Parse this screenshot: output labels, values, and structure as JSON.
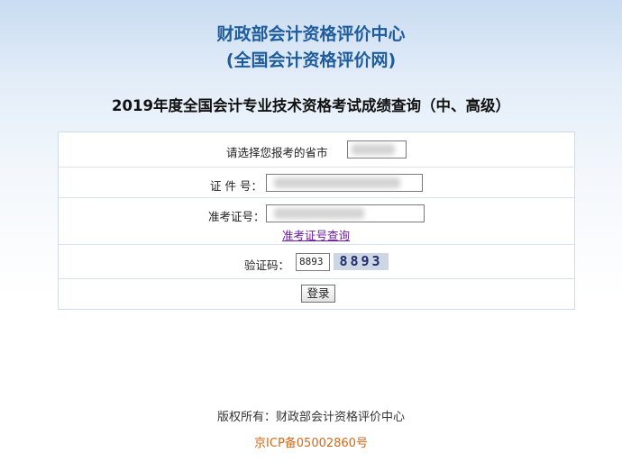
{
  "header": {
    "org_name": "财政部会计资格评价中心",
    "site_name": "(全国会计资格评价网)",
    "query_title": "2019年度全国会计专业技术资格考试成绩查询（中、高级）"
  },
  "form": {
    "province_label": "请选择您报考的省市",
    "id_label": "证 件 号：",
    "admission_label": "准考证号：",
    "admission_lookup_link": "准考证号查询",
    "captcha_label": "验证码：",
    "captcha_input_value": "8893",
    "captcha_image_text": "8893",
    "login_button": "登录"
  },
  "footer": {
    "copyright": "版权所有：财政部会计资格评价中心",
    "icp": "京ICP备05002860号"
  },
  "colors": {
    "title_blue": "#1f5c9c",
    "link_purple": "#6a1ca0",
    "icp_orange": "#d2691e"
  }
}
